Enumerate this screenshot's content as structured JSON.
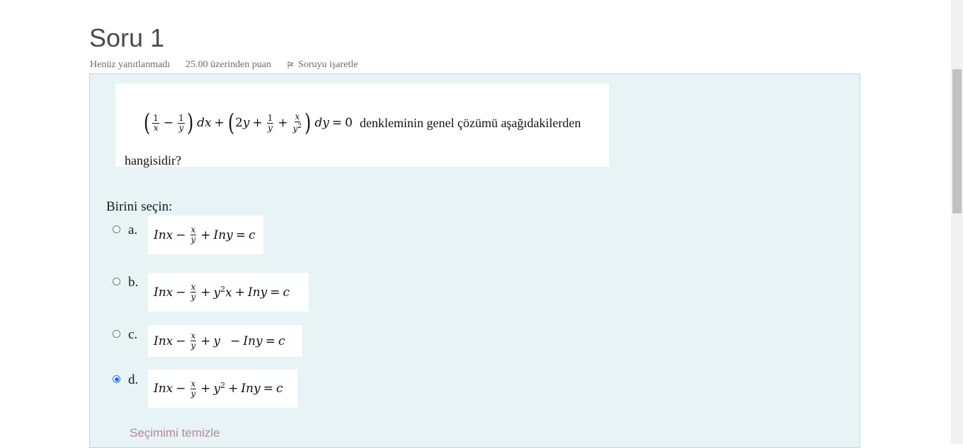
{
  "question": {
    "title": "Soru 1",
    "state": "Henüz yanıtlanmadı",
    "grade": "25.00 üzerinden puan",
    "flag_label": "Soruyu işaretle",
    "text_tail": "denkleminin genel çözümü aşağıdakilerden",
    "text_line2": "hangisidir?"
  },
  "answer": {
    "prompt": "Birini seçin:",
    "options": [
      {
        "letter": "a.",
        "formula": "Inx − x/y + Iny = c",
        "selected": false
      },
      {
        "letter": "b.",
        "formula": "Inx − x/y + y²x + Iny = c",
        "selected": false
      },
      {
        "letter": "c.",
        "formula": "Inx − x/y + y − Iny = c",
        "selected": false
      },
      {
        "letter": "d.",
        "formula": "Inx − x/y + y² + Iny = c",
        "selected": true
      }
    ],
    "clear_label": "Seçimimi temizle"
  },
  "colors": {
    "content_bg": "#e7f3f5",
    "content_border": "#b8dce2",
    "selected_radio": "#1a73e8",
    "clear_link": "#b38a98"
  },
  "icons": {
    "flag": "flag-icon"
  }
}
